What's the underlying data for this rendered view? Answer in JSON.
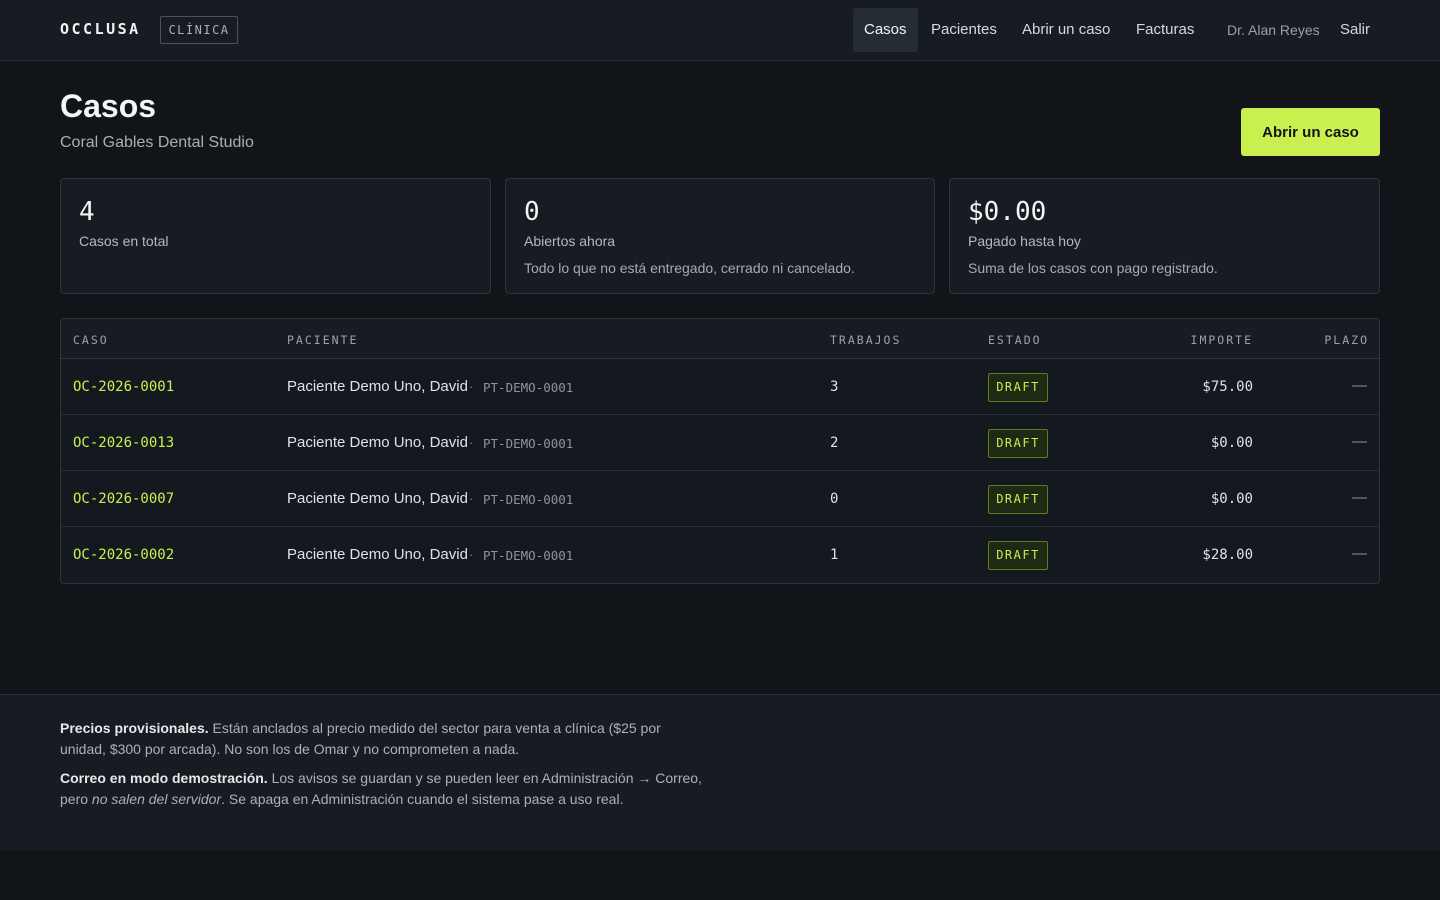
{
  "brand": {
    "name": "OCCLUSA",
    "tag": "CLÍNICA"
  },
  "nav": {
    "items": [
      "Casos",
      "Pacientes",
      "Abrir un caso",
      "Facturas"
    ],
    "active": "Casos",
    "user": "Dr. Alan Reyes",
    "logout": "Salir"
  },
  "header": {
    "title": "Casos",
    "subtitle": "Coral Gables Dental Studio",
    "primary_action": "Abrir un caso"
  },
  "stats": [
    {
      "value": "4",
      "label": "Casos en total",
      "note": ""
    },
    {
      "value": "0",
      "label": "Abiertos ahora",
      "note": "Todo lo que no está entregado, cerrado ni cancelado."
    },
    {
      "value": "$0.00",
      "label": "Pagado hasta hoy",
      "note": "Suma de los casos con pago registrado."
    }
  ],
  "table": {
    "columns": [
      "CASO",
      "PACIENTE",
      "TRABAJOS",
      "ESTADO",
      "IMPORTE",
      "PLAZO"
    ],
    "rows": [
      {
        "case": "OC-2026-0001",
        "patient": "Paciente Demo Uno, David",
        "separator": "·",
        "patient_id": "PT-DEMO-0001",
        "jobs": "3",
        "status": "DRAFT",
        "amount": "$75.00",
        "deadline": "—"
      },
      {
        "case": "OC-2026-0013",
        "patient": "Paciente Demo Uno, David",
        "separator": "·",
        "patient_id": "PT-DEMO-0001",
        "jobs": "2",
        "status": "DRAFT",
        "amount": "$0.00",
        "deadline": "—"
      },
      {
        "case": "OC-2026-0007",
        "patient": "Paciente Demo Uno, David",
        "separator": "·",
        "patient_id": "PT-DEMO-0001",
        "jobs": "0",
        "status": "DRAFT",
        "amount": "$0.00",
        "deadline": "—"
      },
      {
        "case": "OC-2026-0002",
        "patient": "Paciente Demo Uno, David",
        "separator": "·",
        "patient_id": "PT-DEMO-0001",
        "jobs": "1",
        "status": "DRAFT",
        "amount": "$28.00",
        "deadline": "—"
      }
    ]
  },
  "footer": {
    "pricing_title": "Precios provisionales.",
    "pricing_text": " Están anclados al precio medido del sector para venta a clínica ($25 por unidad, $300 por arcada). No son los de Omar y no comprometen a nada.",
    "mail_title": "Correo en modo demostración.",
    "mail_text_1": " Los avisos se guardan y se pueden leer en Administración → Correo, pero ",
    "mail_text_em": "no salen del servidor",
    "mail_text_2": ". Se apaga en Administración cuando el sistema pase a uso real."
  },
  "colors": {
    "accent": "#c9f04e",
    "background": "#111519",
    "surface": "#171c22",
    "border": "#2c333b"
  }
}
